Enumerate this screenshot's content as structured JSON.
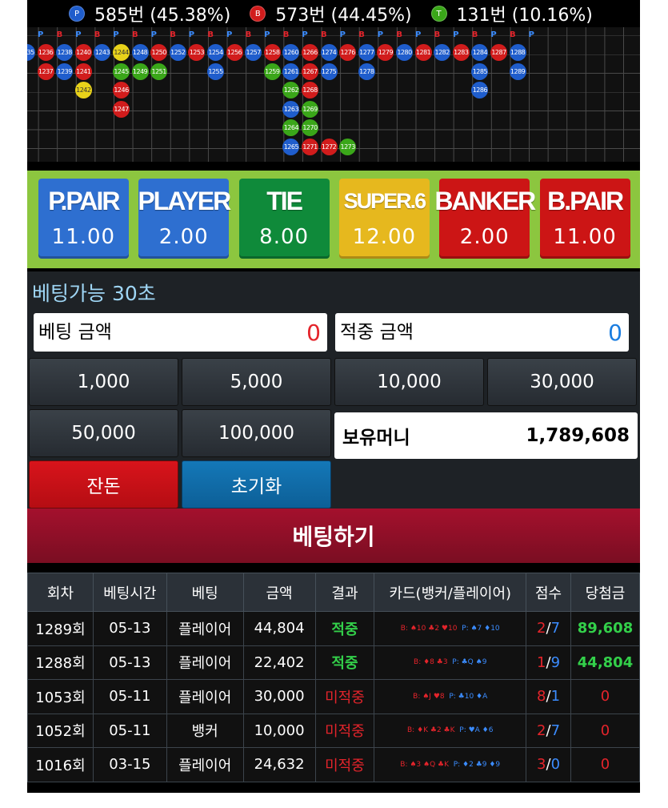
{
  "stats": [
    {
      "badge": "P",
      "color": "#1f5dcc",
      "text": "585번 (45.38%)"
    },
    {
      "badge": "B",
      "color": "#d11c1c",
      "text": "573번 (44.45%)"
    },
    {
      "badge": "T",
      "color": "#3aa619",
      "text": "131번 (10.16%)"
    }
  ],
  "road": {
    "header": [
      "P",
      "B",
      "P",
      "B",
      "P",
      "B",
      "P",
      "B",
      "P",
      "B",
      "P",
      "B",
      "P",
      "B",
      "P",
      "B",
      "P",
      "B",
      "P",
      "B",
      "P",
      "B",
      "P",
      "B",
      "P",
      "B",
      "P"
    ],
    "columns": [
      [
        {
          "n": "1235",
          "c": "b"
        }
      ],
      [
        {
          "n": "1236",
          "c": "r"
        },
        {
          "n": "1237",
          "c": "r"
        }
      ],
      [
        {
          "n": "1238",
          "c": "b"
        },
        {
          "n": "1239",
          "c": "b"
        }
      ],
      [
        {
          "n": "1240",
          "c": "r"
        },
        {
          "n": "1241",
          "c": "r"
        },
        {
          "n": "1242",
          "c": "y"
        }
      ],
      [
        {
          "n": "1243",
          "c": "b"
        }
      ],
      [
        {
          "n": "1244",
          "c": "y"
        },
        {
          "n": "1245",
          "c": "g"
        },
        {
          "n": "1246",
          "c": "r"
        },
        {
          "n": "1247",
          "c": "r"
        }
      ],
      [
        {
          "n": "1248",
          "c": "b"
        },
        {
          "n": "1249",
          "c": "g"
        }
      ],
      [
        {
          "n": "1250",
          "c": "r"
        },
        {
          "n": "1251",
          "c": "g"
        }
      ],
      [
        {
          "n": "1252",
          "c": "b"
        }
      ],
      [
        {
          "n": "1253",
          "c": "r"
        }
      ],
      [
        {
          "n": "1254",
          "c": "b"
        },
        {
          "n": "1255",
          "c": "b"
        }
      ],
      [
        {
          "n": "1256",
          "c": "r"
        }
      ],
      [
        {
          "n": "1257",
          "c": "b"
        }
      ],
      [
        {
          "n": "1258",
          "c": "r"
        },
        {
          "n": "1259",
          "c": "g"
        }
      ],
      [
        {
          "n": "1260",
          "c": "b"
        },
        {
          "n": "1261",
          "c": "b"
        },
        {
          "n": "1262",
          "c": "g"
        },
        {
          "n": "1263",
          "c": "b"
        },
        {
          "n": "1264",
          "c": "g"
        },
        {
          "n": "1265",
          "c": "b"
        }
      ],
      [
        {
          "n": "1266",
          "c": "r"
        },
        {
          "n": "1267",
          "c": "r"
        },
        {
          "n": "1268",
          "c": "r"
        },
        {
          "n": "1269",
          "c": "g"
        },
        {
          "n": "1270",
          "c": "g"
        },
        {
          "n": "1271",
          "c": "r"
        }
      ],
      [
        {
          "n": "1274",
          "c": "b"
        },
        {
          "n": "1275",
          "c": "b"
        },
        null,
        null,
        null,
        {
          "n": "1272",
          "c": "r"
        }
      ],
      [
        {
          "n": "1276",
          "c": "r"
        },
        null,
        null,
        null,
        null,
        {
          "n": "1273",
          "c": "g"
        }
      ],
      [
        {
          "n": "1277",
          "c": "b"
        },
        {
          "n": "1278",
          "c": "b"
        }
      ],
      [
        {
          "n": "1279",
          "c": "r"
        }
      ],
      [
        {
          "n": "1280",
          "c": "b"
        }
      ],
      [
        {
          "n": "1281",
          "c": "r"
        }
      ],
      [
        {
          "n": "1282",
          "c": "b"
        }
      ],
      [
        {
          "n": "1283",
          "c": "r"
        }
      ],
      [
        {
          "n": "1284",
          "c": "b"
        },
        {
          "n": "1285",
          "c": "b"
        },
        {
          "n": "1286",
          "c": "b"
        }
      ],
      [
        {
          "n": "1287",
          "c": "r"
        }
      ],
      [
        {
          "n": "1288",
          "c": "b"
        },
        {
          "n": "1289",
          "c": "b"
        }
      ]
    ]
  },
  "bets": [
    {
      "label": "P.PAIR",
      "odds": "11.00",
      "color": "#2e6fd0"
    },
    {
      "label": "PLAYER",
      "odds": "2.00",
      "color": "#2e6fd0"
    },
    {
      "label": "TIE",
      "odds": "8.00",
      "color": "#0f8a3a"
    },
    {
      "label": "SUPER.6",
      "odds": "12.00",
      "color": "#e6b81e"
    },
    {
      "label": "BANKER",
      "odds": "2.00",
      "color": "#cc1515"
    },
    {
      "label": "B.PAIR",
      "odds": "11.00",
      "color": "#cc1515"
    }
  ],
  "timer": "베팅가능 30초",
  "bet_amount": {
    "label": "베팅 금액",
    "value": "0",
    "color": "#e4242b"
  },
  "win_amount": {
    "label": "적중 금액",
    "value": "0",
    "color": "#1a7de0"
  },
  "chips": [
    "1,000",
    "5,000",
    "10,000",
    "30,000",
    "50,000",
    "100,000"
  ],
  "holdings": {
    "label": "보유머니",
    "value": "1,789,608"
  },
  "change_button": "잔돈",
  "reset_button": "초기화",
  "submit_button": "베팅하기",
  "table": {
    "headers": [
      "회차",
      "베팅시간",
      "베팅",
      "금액",
      "결과",
      "카드(뱅커/플레이어)",
      "점수",
      "당첨금"
    ],
    "rows": [
      {
        "round": "1289회",
        "time": "05-13",
        "bet": "플레이어",
        "amount": "44,804",
        "result": "적중",
        "win": true,
        "cards_b": "B: ♠10 ♣2 ♥10",
        "cards_p": "P: ♠7 ♦10",
        "score_b": "2",
        "score_p": "7",
        "payout": "89,608"
      },
      {
        "round": "1288회",
        "time": "05-13",
        "bet": "플레이어",
        "amount": "22,402",
        "result": "적중",
        "win": true,
        "cards_b": "B: ♦8 ♣3",
        "cards_p": "P: ♣Q ♠9",
        "score_b": "1",
        "score_p": "9",
        "payout": "44,804"
      },
      {
        "round": "1053회",
        "time": "05-11",
        "bet": "플레이어",
        "amount": "30,000",
        "result": "미적중",
        "win": false,
        "cards_b": "B: ♠J ♥8",
        "cards_p": "P: ♣10 ♦A",
        "score_b": "8",
        "score_p": "1",
        "payout": "0"
      },
      {
        "round": "1052회",
        "time": "05-11",
        "bet": "뱅커",
        "amount": "10,000",
        "result": "미적중",
        "win": false,
        "cards_b": "B: ♦K ♣2 ♣K",
        "cards_p": "P: ♥A ♦6",
        "score_b": "2",
        "score_p": "7",
        "payout": "0"
      },
      {
        "round": "1016회",
        "time": "03-15",
        "bet": "플레이어",
        "amount": "24,632",
        "result": "미적중",
        "win": false,
        "cards_b": "B: ♠3 ♠Q ♣K",
        "cards_p": "P: ♦2 ♣9 ♦9",
        "score_b": "3",
        "score_p": "0",
        "payout": "0"
      }
    ]
  }
}
